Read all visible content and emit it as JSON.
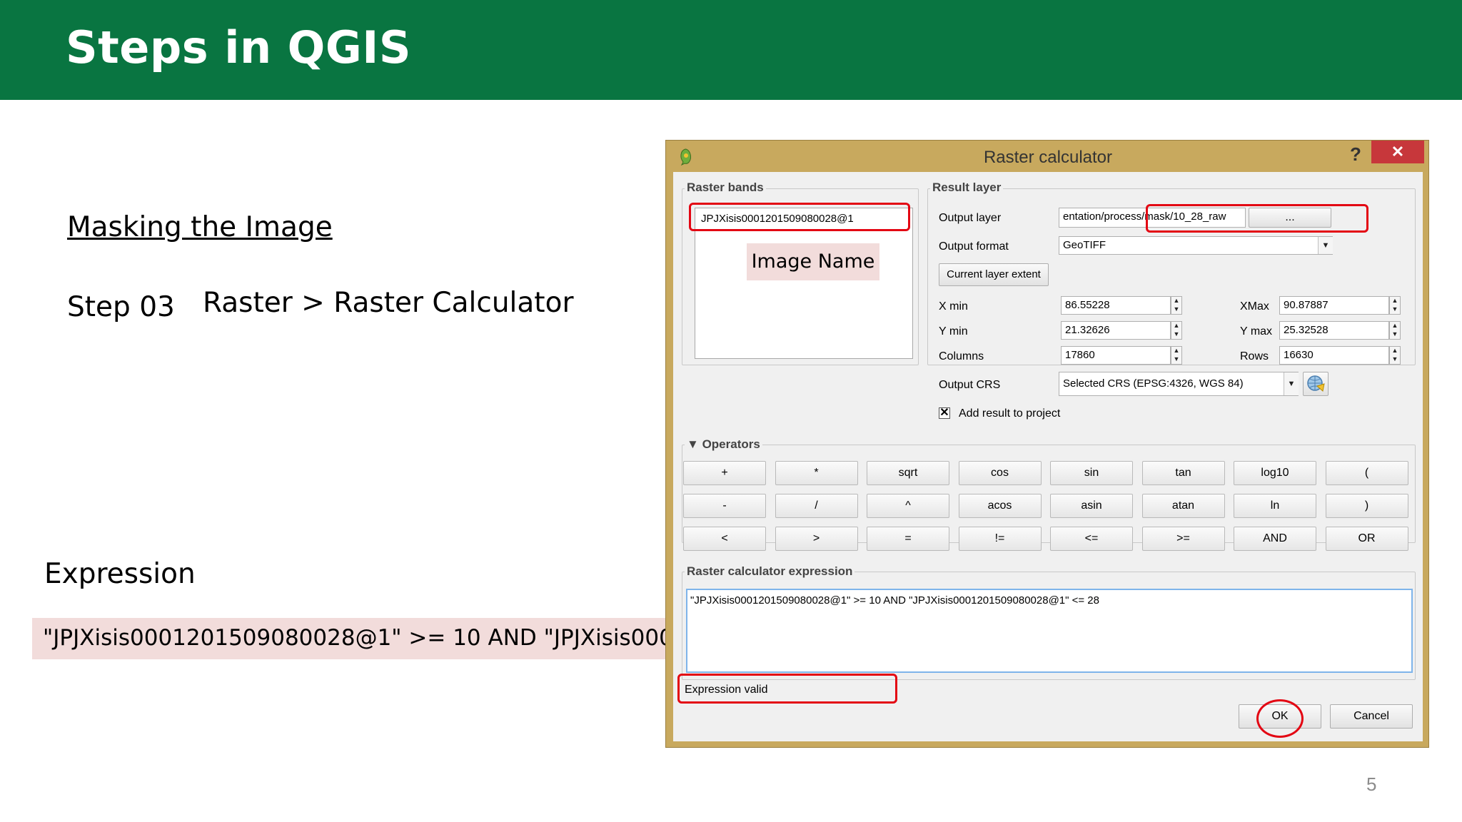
{
  "slide": {
    "title": "Steps in QGIS",
    "subtitle": "Masking the Image",
    "step_label": "Step 03",
    "step_desc": "Raster > Raster Calculator",
    "expression_heading": "Expression",
    "expression_text": "\"JPJXisis0001201509080028@1\" >= 10 AND \"JPJXisis0001201509080028@1\" <= 28",
    "page_number": "5"
  },
  "dialog": {
    "title": "Raster calculator",
    "help": "?",
    "close": "✕",
    "raster_bands": {
      "title": "Raster bands",
      "items": [
        "JPJXisis0001201509080028@1"
      ],
      "annotation": "Image Name"
    },
    "result_layer": {
      "title": "Result layer",
      "output_layer_label": "Output layer",
      "output_layer_value": "entation/process/mask/10_28_raw",
      "browse_label": "...",
      "output_format_label": "Output format",
      "output_format_value": "GeoTIFF",
      "current_extent_label": "Current layer extent",
      "xmin_label": "X min",
      "xmin_value": "86.55228",
      "xmax_label": "XMax",
      "xmax_value": "90.87887",
      "ymin_label": "Y min",
      "ymin_value": "21.32626",
      "ymax_label": "Y max",
      "ymax_value": "25.32528",
      "columns_label": "Columns",
      "columns_value": "17860",
      "rows_label": "Rows",
      "rows_value": "16630",
      "crs_label": "Output CRS",
      "crs_value": "Selected CRS (EPSG:4326, WGS 84)",
      "add_result_label": "Add result to project",
      "add_result_checked": true
    },
    "operators": {
      "title": "Operators",
      "rows": [
        [
          "+",
          "*",
          "sqrt",
          "cos",
          "sin",
          "tan",
          "log10",
          "("
        ],
        [
          "-",
          "/",
          "^",
          "acos",
          "asin",
          "atan",
          "ln",
          ")"
        ],
        [
          "<",
          ">",
          "=",
          "!=",
          "<=",
          ">=",
          "AND",
          "OR"
        ]
      ]
    },
    "expression": {
      "title": "Raster calculator expression",
      "value": "\"JPJXisis0001201509080028@1\" >= 10 AND \"JPJXisis0001201509080028@1\" <= 28",
      "status": "Expression valid"
    },
    "buttons": {
      "ok": "OK",
      "cancel": "Cancel"
    }
  },
  "colors": {
    "banner": "#097541",
    "dialog_frame": "#c8a95e",
    "highlight": "#f2dcdb",
    "annotation_red": "#e30613",
    "close_button": "#c7373b"
  }
}
